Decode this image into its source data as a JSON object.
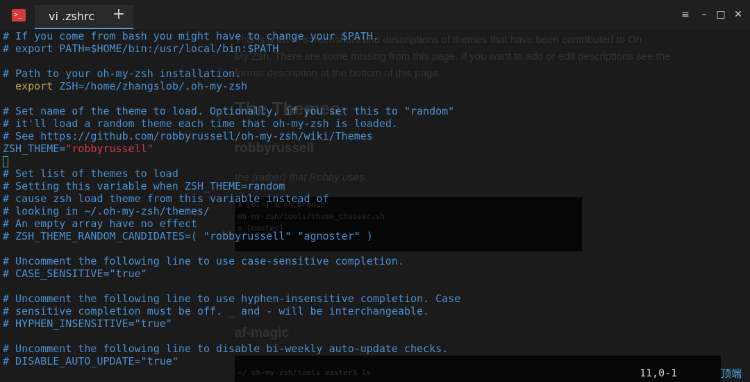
{
  "titlebar": {
    "tab_title": "vi .zshrc",
    "new_tab": "+",
    "app_icon_glyph": ">_",
    "window_buttons": {
      "menu": "≡",
      "minimize": "–",
      "maximize": "□",
      "close": "✕"
    }
  },
  "background_page": {
    "para_line1": "This is a list of screenshots and descriptions of themes that have been contributed to Oh",
    "para_line2": "My Zsh. There are some missing from this page. If you want to add or edit descriptions see the",
    "para_line3": "format description at the bottom of this page.",
    "heading_themes": "The Themes",
    "heading_robbyrussell": "robbyrussell",
    "robby_desc": "the (rather) that Robby uses",
    "code1_line1": "                         $ [dir] ± ch:branch",
    "code1_line2": "  oh-my-zsh/tools/theme_chooser.sh",
    "code1_line3": "                         ± [master]",
    "code1_line4": "                                     /",
    "heading_afmagic": "af-magic",
    "code2_line1": "  ~/.oh-my-zsh/tools master$ ls"
  },
  "editor": {
    "lines": [
      {
        "segments": [
          {
            "t": "# If you come from bash you might have to change your $PATH.",
            "c": "cmt"
          }
        ]
      },
      {
        "segments": [
          {
            "t": "# export PATH=$HOME/bin:/usr/local/bin:$PATH",
            "c": "cmt"
          }
        ]
      },
      {
        "segments": [
          {
            "t": "",
            "c": "cmt"
          }
        ]
      },
      {
        "segments": [
          {
            "t": "# Path to your oh-my-zsh installation.",
            "c": "cmt"
          }
        ]
      },
      {
        "segments": [
          {
            "t": "  export",
            "c": "kw"
          },
          {
            "t": " ZSH=/home/zhangslob/.oh-my-zsh",
            "c": "plain"
          }
        ]
      },
      {
        "segments": [
          {
            "t": "",
            "c": "cmt"
          }
        ]
      },
      {
        "segments": [
          {
            "t": "# Set name of the theme to load. Optionally, if you set this to \"random\"",
            "c": "cmt"
          }
        ]
      },
      {
        "segments": [
          {
            "t": "# it'll load a random theme each time that oh-my-zsh is loaded.",
            "c": "cmt"
          }
        ]
      },
      {
        "segments": [
          {
            "t": "# See https://github.com/robbyrussell/oh-my-zsh/wiki/Themes",
            "c": "cmt"
          }
        ]
      },
      {
        "segments": [
          {
            "t": "ZSH_THEME=",
            "c": "var"
          },
          {
            "t": "\"robbyrussell\"",
            "c": "str"
          }
        ]
      },
      {
        "segments": [],
        "cursor": true
      },
      {
        "segments": [
          {
            "t": "# Set list of themes to load",
            "c": "cmt"
          }
        ]
      },
      {
        "segments": [
          {
            "t": "# Setting this variable when ZSH_THEME=random",
            "c": "cmt"
          }
        ]
      },
      {
        "segments": [
          {
            "t": "# cause zsh load theme from this variable instead of",
            "c": "cmt"
          }
        ]
      },
      {
        "segments": [
          {
            "t": "# looking in ~/.oh-my-zsh/themes/",
            "c": "cmt"
          }
        ]
      },
      {
        "segments": [
          {
            "t": "# An empty array have no effect",
            "c": "cmt"
          }
        ]
      },
      {
        "segments": [
          {
            "t": "# ZSH_THEME_RANDOM_CANDIDATES=( \"robbyrussell\" \"agnoster\" )",
            "c": "cmt"
          }
        ]
      },
      {
        "segments": [
          {
            "t": "",
            "c": "cmt"
          }
        ]
      },
      {
        "segments": [
          {
            "t": "# Uncomment the following line to use case-sensitive completion.",
            "c": "cmt"
          }
        ]
      },
      {
        "segments": [
          {
            "t": "# CASE_SENSITIVE=\"true\"",
            "c": "cmt"
          }
        ]
      },
      {
        "segments": [
          {
            "t": "",
            "c": "cmt"
          }
        ]
      },
      {
        "segments": [
          {
            "t": "# Uncomment the following line to use hyphen-insensitive completion. Case",
            "c": "cmt"
          }
        ]
      },
      {
        "segments": [
          {
            "t": "# sensitive completion must be off. _ and - will be interchangeable.",
            "c": "cmt"
          }
        ]
      },
      {
        "segments": [
          {
            "t": "# HYPHEN_INSENSITIVE=\"true\"",
            "c": "cmt"
          }
        ]
      },
      {
        "segments": [
          {
            "t": "",
            "c": "cmt"
          }
        ]
      },
      {
        "segments": [
          {
            "t": "# Uncomment the following line to disable bi-weekly auto-update checks.",
            "c": "cmt"
          }
        ]
      },
      {
        "segments": [
          {
            "t": "# DISABLE_AUTO_UPDATE=\"true\"",
            "c": "cmt"
          }
        ]
      }
    ]
  },
  "status": {
    "cursor_position": "11,0-1",
    "scroll_position": "顶端"
  },
  "colors": {
    "comment": "#4b8fd0",
    "keyword": "#b8a14a",
    "string": "#cf3a42",
    "accent": "#4aa3df",
    "background": "#1c1c1c"
  }
}
